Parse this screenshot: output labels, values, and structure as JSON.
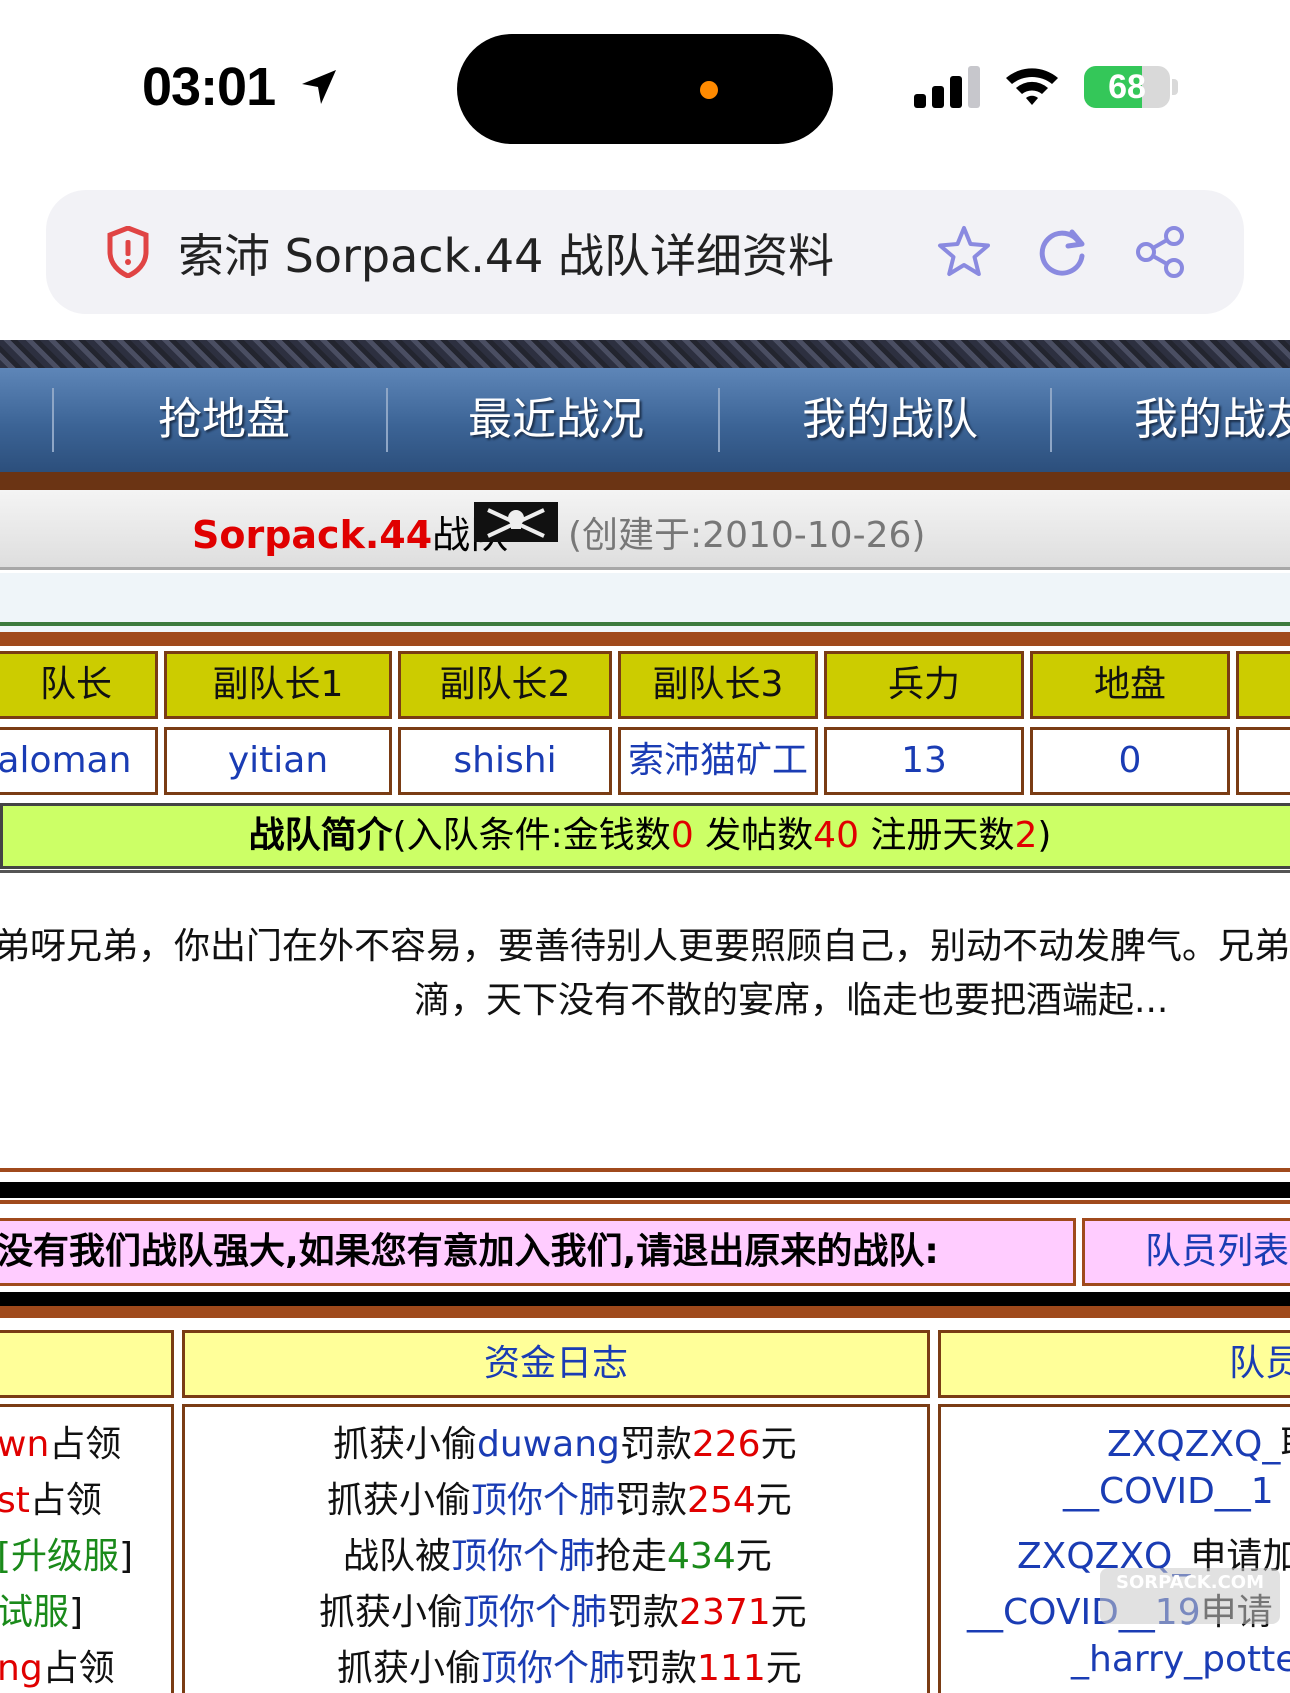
{
  "status_bar": {
    "time": "03:01",
    "battery": "68",
    "battery_level": 0.68
  },
  "browser": {
    "page_title": "索沛 Sorpack.44 战队详细资料",
    "icons": [
      "shield-alert-icon",
      "star-icon",
      "reload-icon",
      "share-icon"
    ]
  },
  "nav": {
    "items": [
      "抢地盘",
      "最近战况",
      "我的战队",
      "我的战友"
    ]
  },
  "team": {
    "name": "Sorpack.44",
    "name_suffix": "战队",
    "created": "(创建于:2010-10-26)"
  },
  "roster": {
    "headers": [
      "队长",
      "副队长1",
      "副队长2",
      "副队长3",
      "兵力",
      "地盘"
    ],
    "values": [
      "paloman",
      "yitian",
      "shishi",
      "索沛猫矿工",
      "13",
      "0"
    ]
  },
  "intro": {
    "title": "战队简介",
    "prefix": "(入队条件:金钱数",
    "money": "0",
    "posts_label": " 发帖数",
    "posts": "40",
    "days_label": " 注册天数",
    "days": "2",
    "suffix": ")"
  },
  "description": {
    "line1": "弟呀兄弟，你出门在外不容易，要善待别人更要照顾自己，别动不动发脾气。兄弟",
    "line2": "滴，天下没有不散的宴席，临走也要把酒端起..."
  },
  "recruit": {
    "text": "没有我们战队强大,如果您有意加入我们,请退出原来的战队:",
    "members_link": "队员列表"
  },
  "sections": {
    "funds_log": "资金日志",
    "members": "队员"
  },
  "left_log": [
    {
      "name": "wn",
      "action": "占领"
    },
    {
      "name": "st",
      "action": "占领"
    },
    {
      "name": "[升级服",
      "action": "]"
    },
    {
      "name": "试服",
      "action": "]"
    },
    {
      "name": "ng",
      "action": "占领"
    }
  ],
  "funds_log": [
    {
      "pre": "抓获小偷",
      "name": "duwang",
      "mid": "罚款",
      "amount": "226",
      "post": "元"
    },
    {
      "pre": "抓获小偷",
      "name": "顶你个肺",
      "mid": "罚款",
      "amount": "254",
      "post": "元"
    },
    {
      "pre": "战队被",
      "name": "顶你个肺",
      "mid": "抢走",
      "amount": "434",
      "post": "元"
    },
    {
      "pre": "抓获小偷",
      "name": "顶你个肺",
      "mid": "罚款",
      "amount": "2371",
      "post": "元"
    },
    {
      "pre": "抓获小偷",
      "name": "顶你个肺",
      "mid": "罚款",
      "amount": "111",
      "post": "元"
    }
  ],
  "member_log": [
    {
      "name": "ZXQZXQ_",
      "action": "取"
    },
    {
      "name": "__COVID__1",
      "action": ""
    },
    {
      "name": "ZXQZXQ_",
      "action": "申请加"
    },
    {
      "name": "__COVID__19",
      "action": "申请"
    },
    {
      "name": "_harry_potter",
      "action": ""
    }
  ],
  "watermark": "SORPACK.COM",
  "colors": {
    "nav_blue": "#3c6496",
    "header_olive": "#cccc00",
    "intro_green": "#ccff66",
    "recruit_pink": "#ffccff",
    "section_yellow": "#ffff99",
    "border_brown": "#7a3c14",
    "link_blue": "#1a3cb4",
    "alert_red": "#e00000"
  }
}
